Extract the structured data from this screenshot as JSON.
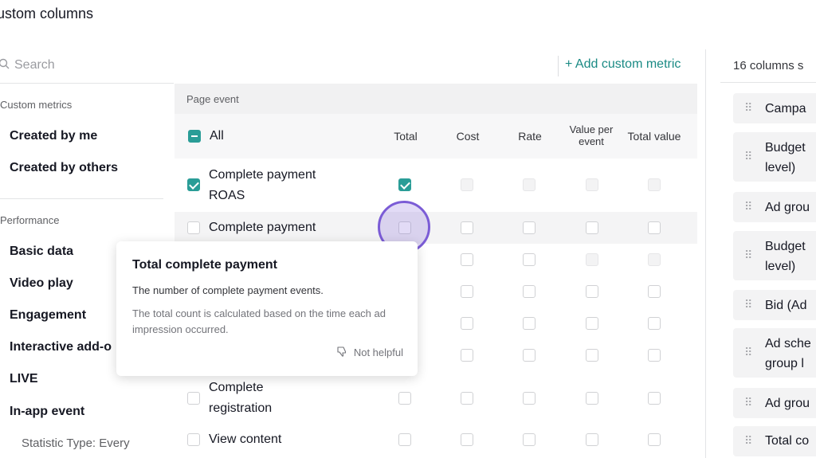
{
  "page": {
    "title": "ustom columns"
  },
  "search": {
    "placeholder": "Search"
  },
  "add_metric": {
    "label": "+ Add custom metric"
  },
  "sidebar": {
    "sections": [
      {
        "label": "Custom metrics",
        "items": [
          "Created by me",
          "Created by others"
        ]
      },
      {
        "label": "Performance",
        "items": [
          "Basic data",
          "Video play",
          "Engagement",
          "Interactive add-o",
          "LIVE",
          "In-app event"
        ]
      }
    ],
    "sub_item": "Statistic Type: Every"
  },
  "table": {
    "group_label": "Page event",
    "all_label": "All",
    "columns": [
      "Total",
      "Cost",
      "Rate",
      "Value per event",
      "Total value"
    ],
    "rows": [
      {
        "label": "Complete payment ROAS",
        "checked": true
      },
      {
        "label": "Complete payment",
        "checked": false
      },
      {
        "label": "",
        "checked": false
      },
      {
        "label": "",
        "checked": false
      },
      {
        "label": "",
        "checked": false
      },
      {
        "label": "",
        "checked": false
      },
      {
        "label": "Complete registration",
        "checked": false
      },
      {
        "label": "View content",
        "checked": false
      }
    ]
  },
  "tooltip": {
    "title": "Total complete payment",
    "description": "The number of complete payment events.",
    "note": "The total count is calculated based on the time each ad impression occurred.",
    "feedback": "Not helpful"
  },
  "right_panel": {
    "header": "16 columns s",
    "items": [
      "Campa",
      "Budget level)",
      "Ad grou",
      "Budget level)",
      "Bid (Ad",
      "Ad sche group l",
      "Ad grou",
      "Total co"
    ]
  },
  "colors": {
    "accent": "#2a9d97",
    "link": "#1a8a84",
    "highlight": "#7b5cd6"
  }
}
